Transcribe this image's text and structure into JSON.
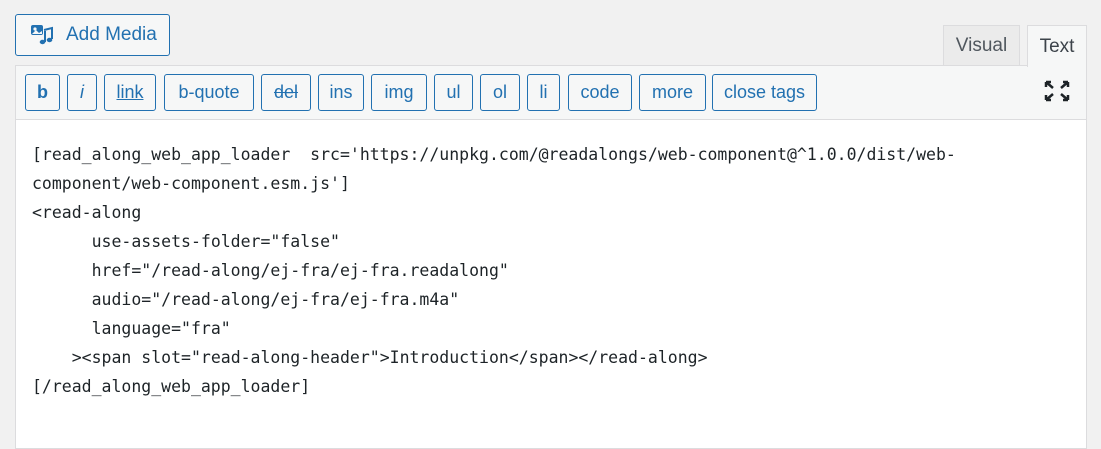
{
  "media": {
    "add_media_label": "Add Media"
  },
  "tabs": {
    "visual": "Visual",
    "text": "Text"
  },
  "quicktags": [
    "b",
    "i",
    "link",
    "b-quote",
    "del",
    "ins",
    "img",
    "ul",
    "ol",
    "li",
    "code",
    "more",
    "close tags"
  ],
  "editor": {
    "lines": [
      "[read_along_web_app_loader  src='https://unpkg.com/@readalongs/web-component@^1.0.0/dist/web-",
      "component/web-component.esm.js']",
      "<read-along",
      "      use-assets-folder=\"false\"",
      "      href=\"/read-along/ej-fra/ej-fra.readalong\"",
      "      audio=\"/read-along/ej-fra/ej-fra.m4a\"",
      "      language=\"fra\"",
      "    ><span slot=\"read-along-header\">Introduction</span></read-along>",
      "[/read_along_web_app_loader]"
    ]
  },
  "icons": {
    "add_media": "media-upload-icon",
    "fullscreen": "fullscreen-icon"
  },
  "colors": {
    "accent": "#2271b1",
    "background": "#f1f1f1",
    "editor_bg": "#ffffff",
    "text": "#1d2327"
  }
}
